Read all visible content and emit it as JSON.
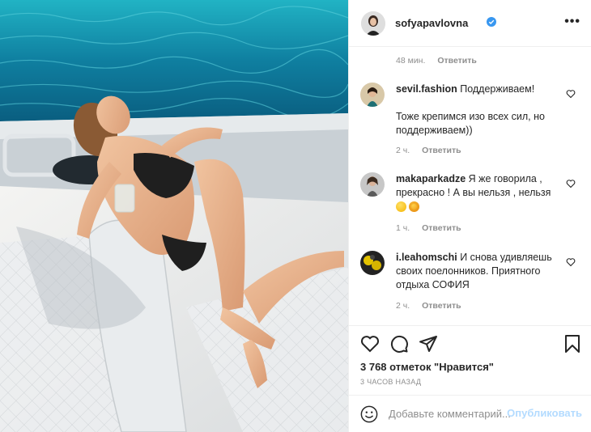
{
  "header": {
    "username": "sofyapavlovna",
    "more_label": "•••",
    "verified_icon": "verified-badge-icon",
    "colors": {
      "verified": "#3897f0"
    }
  },
  "comments": {
    "first_meta": {
      "time": "48 мин.",
      "reply": "Ответить"
    },
    "items": [
      {
        "username": "sevil.fashion",
        "text": "Поддерживаем!",
        "text2": "Тоже крепимся изо всех сил, но поддерживаем))",
        "time": "2 ч.",
        "reply": "Ответить"
      },
      {
        "username": "makaparkadze",
        "text": "Я же говорила , прекрасно ! А вы нельзя , нельзя",
        "emojis": [
          "grinning-sweat-emoji",
          "star-struck-emoji"
        ],
        "time": "1 ч.",
        "reply": "Ответить"
      },
      {
        "username": "i.leahomschi",
        "text": "И снова удивляешь своих поелонников. Приятного отдыха СОФИЯ",
        "time": "2 ч.",
        "reply": "Ответить"
      }
    ]
  },
  "actions": {
    "icons": [
      "heart-icon",
      "comment-icon",
      "share-icon",
      "bookmark-icon"
    ],
    "likes": "3 768 отметок \"Нравится\"",
    "timestamp": "3 ЧАСОВ НАЗАД"
  },
  "add_comment": {
    "placeholder": "Добавьте комментарий...",
    "publish": "Опубликовать",
    "colors": {
      "publish": "#b3dbff"
    }
  }
}
